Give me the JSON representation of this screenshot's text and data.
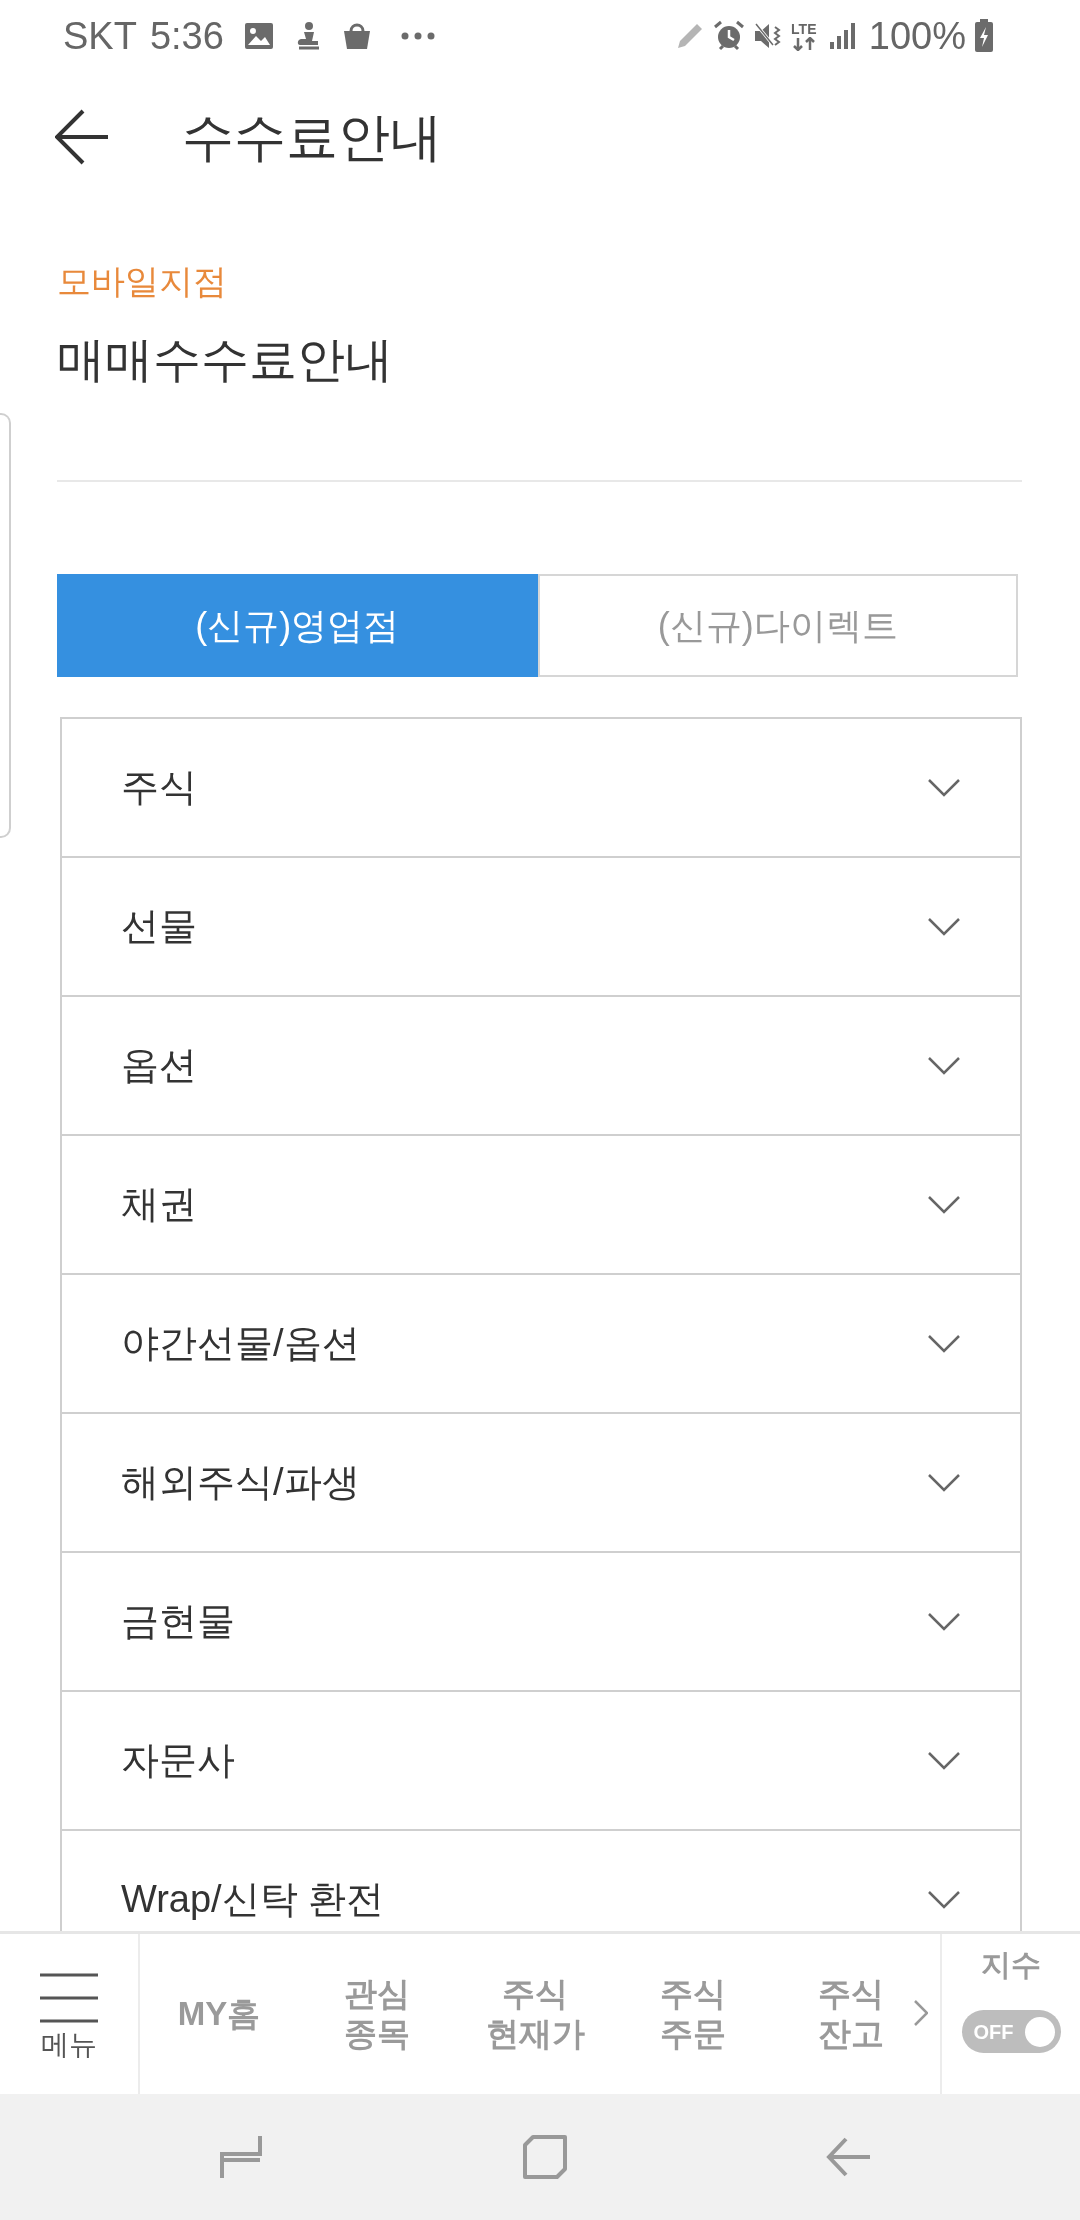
{
  "status_bar": {
    "carrier": "SKT",
    "time": "5:36",
    "network": "LTE",
    "battery": "100%"
  },
  "header": {
    "title": "수수료안내"
  },
  "section": {
    "category": "모바일지점",
    "title": "매매수수료안내"
  },
  "tabs": [
    {
      "label": "(신규)영업점",
      "selected": true
    },
    {
      "label": "(신규)다이렉트",
      "selected": false
    }
  ],
  "fee_list": [
    {
      "label": "주식",
      "expanded": false
    },
    {
      "label": "선물",
      "expanded": false
    },
    {
      "label": "옵션",
      "expanded": false
    },
    {
      "label": "채권",
      "expanded": false
    },
    {
      "label": "야간선물/옵션",
      "expanded": false
    },
    {
      "label": "해외주식/파생",
      "expanded": false
    },
    {
      "label": "금현물",
      "expanded": false
    },
    {
      "label": "자문사",
      "expanded": false
    },
    {
      "label": "Wrap/신탁 환전",
      "expanded": false
    }
  ],
  "bottom_nav": {
    "menu_label": "메뉴",
    "items": [
      {
        "label": "MY홈"
      },
      {
        "label": "관심\n종목"
      },
      {
        "label": "주식\n현재가"
      },
      {
        "label": "주식\n주문"
      },
      {
        "label": "주식\n잔고"
      }
    ],
    "index": {
      "label": "지수",
      "toggle_label": "OFF",
      "on": false
    }
  }
}
